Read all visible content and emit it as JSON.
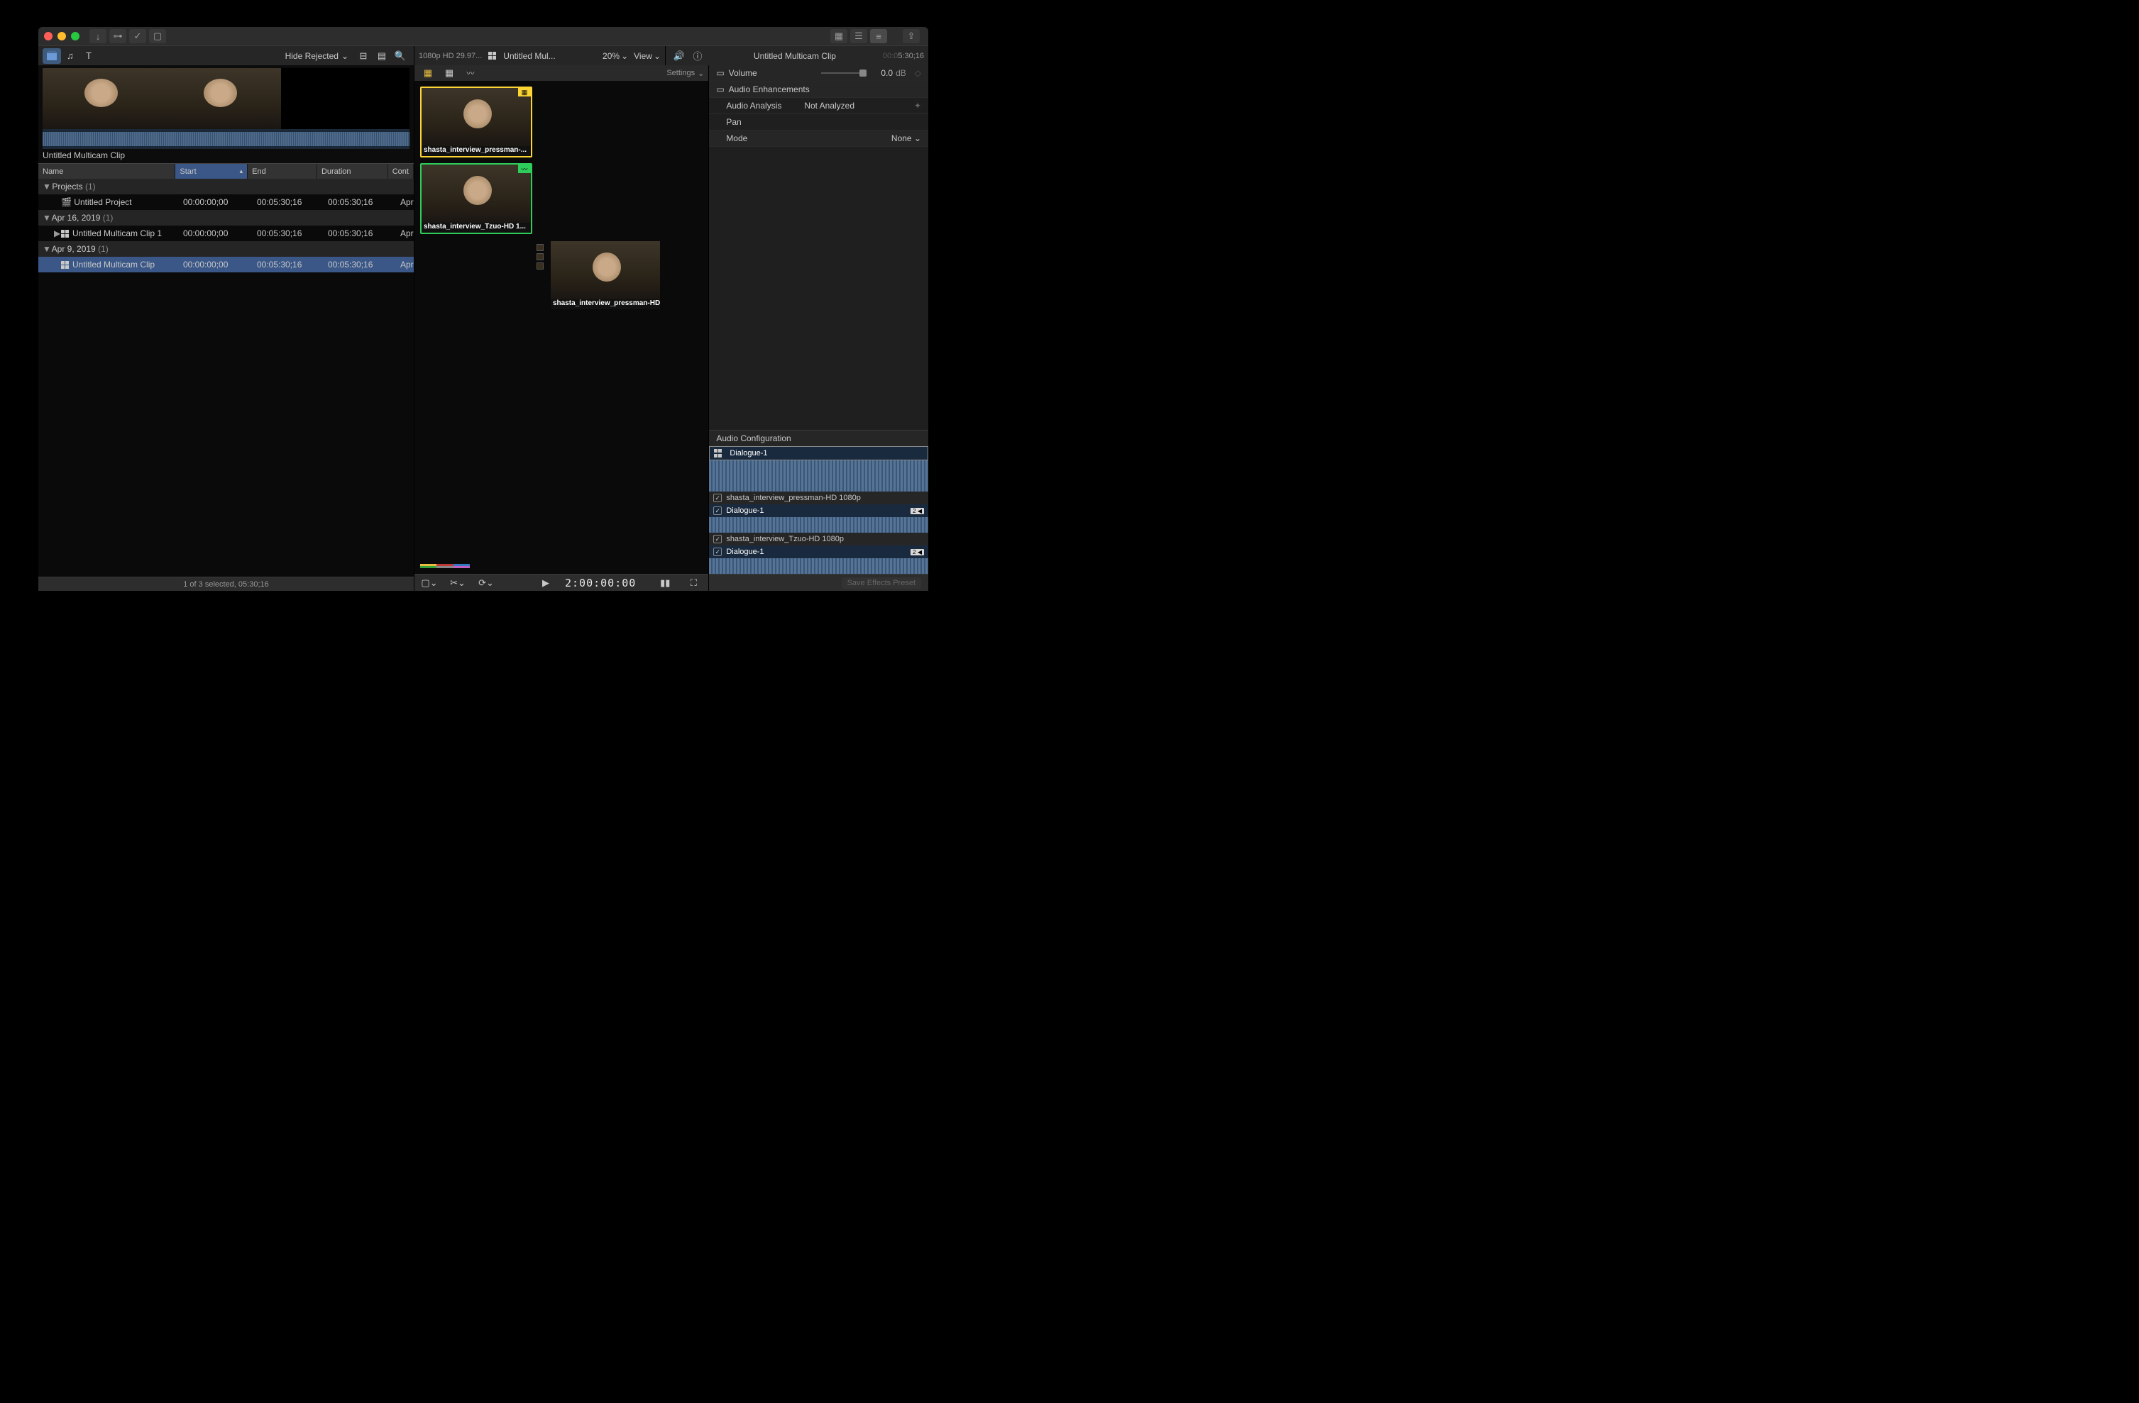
{
  "titlebar": {
    "segments": [
      "grid",
      "list",
      "inspector"
    ]
  },
  "topbar": {
    "hide_rejected": "Hide Rejected",
    "format": "1080p HD 29.97...",
    "project_name": "Untitled Mul...",
    "zoom": "20%",
    "view": "View",
    "inspector_title": "Untitled Multicam Clip",
    "inspector_tc_prefix": "00:0",
    "inspector_tc": "5:30;16"
  },
  "browser": {
    "grid_icon": "⊞",
    "clip_label": "Untitled Multicam Clip",
    "columns": {
      "name": "Name",
      "start": "Start",
      "end": "End",
      "duration": "Duration",
      "content": "Cont"
    },
    "rows": [
      {
        "type": "group",
        "name": "Projects",
        "count": "(1)"
      },
      {
        "type": "item",
        "name": "Untitled Project",
        "icon": "clapper",
        "start": "00:00:00;00",
        "end": "00:05:30;16",
        "duration": "00:05:30;16",
        "content": "Apr"
      },
      {
        "type": "group",
        "name": "Apr 16, 2019",
        "count": "(1)"
      },
      {
        "type": "item",
        "name": "Untitled Multicam Clip 1",
        "icon": "multicam",
        "start": "00:00:00;00",
        "end": "00:05:30;16",
        "duration": "00:05:30;16",
        "content": "Apr",
        "closed": true
      },
      {
        "type": "group",
        "name": "Apr 9, 2019",
        "count": "(1)"
      },
      {
        "type": "item",
        "name": "Untitled Multicam Clip",
        "icon": "multicam",
        "start": "00:00:00;00",
        "end": "00:05:30;16",
        "duration": "00:05:30;16",
        "content": "Apr",
        "selected": true
      }
    ],
    "footer": "1 of 3 selected, 05:30;16"
  },
  "center": {
    "settings": "Settings",
    "angles": [
      {
        "label": "shasta_interview_pressman-...",
        "color": "Y",
        "badge": "film"
      },
      {
        "label": "shasta_interview_Tzuo-HD 1...",
        "color": "G",
        "badge": "audio"
      },
      {
        "label": "shasta_interview_pressman-HD...",
        "color": "",
        "side": true
      }
    ],
    "timecode": "2:00:00:00"
  },
  "inspector": {
    "volume_label": "Volume",
    "volume_value": "0.0",
    "volume_unit": "dB",
    "enh_label": "Audio Enhancements",
    "analysis_label": "Audio Analysis",
    "analysis_value": "Not Analyzed",
    "pan_label": "Pan",
    "mode_label": "Mode",
    "mode_value": "None",
    "config_title": "Audio Configuration",
    "tracks": [
      {
        "label": "Dialogue-1",
        "selected": true
      },
      {
        "comp": "shasta_interview_pressman-HD 1080p"
      },
      {
        "label": "Dialogue-1",
        "tag": "2 ◀",
        "small": true
      },
      {
        "comp": "shasta_interview_Tzuo-HD 1080p"
      },
      {
        "label": "Dialogue-1",
        "tag": "2 ◀",
        "small": true
      }
    ],
    "save_preset": "Save Effects Preset"
  }
}
